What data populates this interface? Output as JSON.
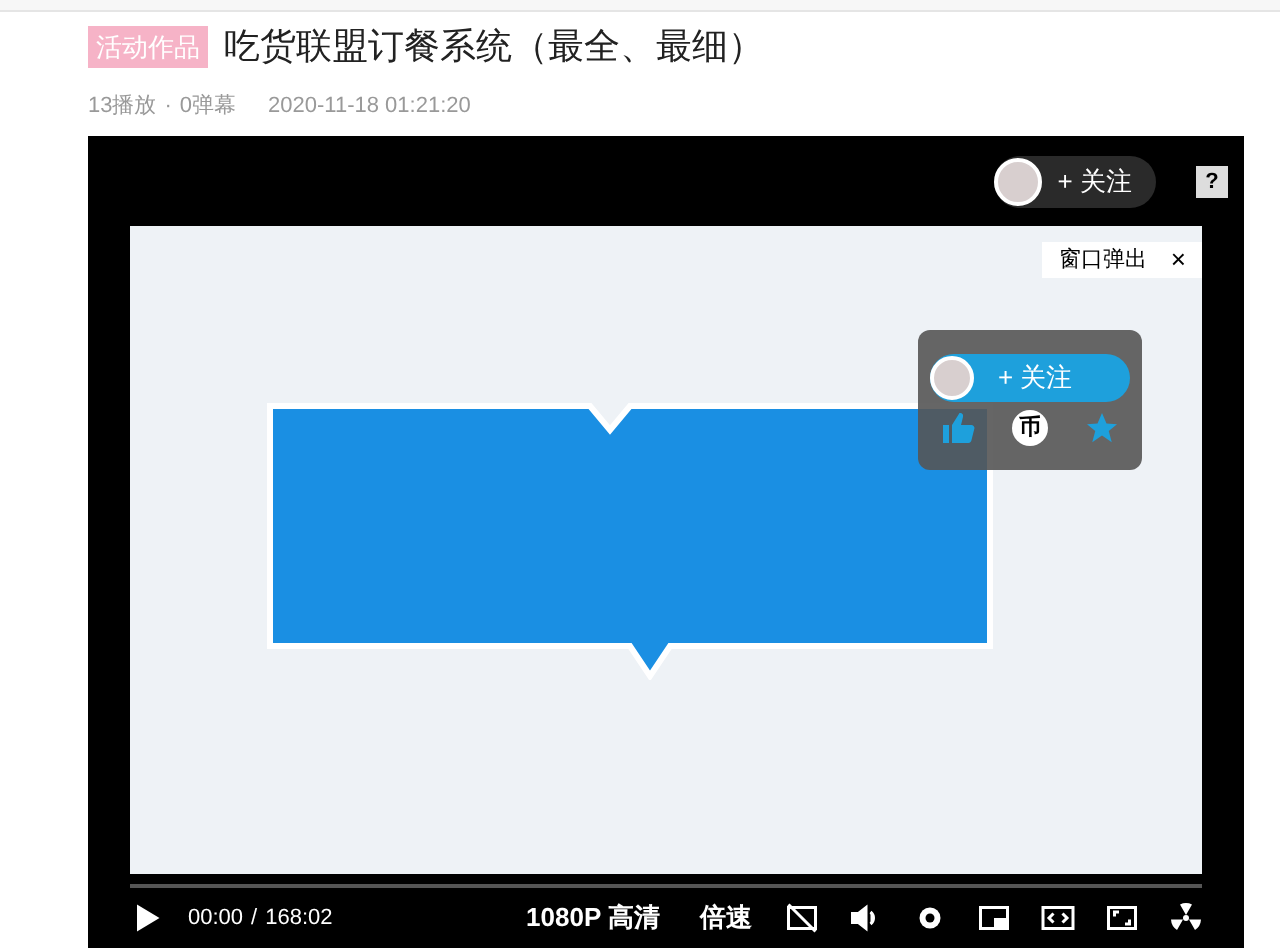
{
  "header": {
    "badge": "活动作品",
    "title": "吃货联盟订餐系统（最全、最细）",
    "plays": "13播放",
    "separator": "·",
    "danmaku": "0弹幕",
    "datetime": "2020-11-18 01:21:20"
  },
  "player": {
    "follow_label": "+ 关注",
    "help_label": "?",
    "popout_label": "窗口弹出",
    "popout_close": "×",
    "float_panel": {
      "follow_label": "+ 关注",
      "coin_label": "币"
    },
    "progress": {
      "level": 0
    },
    "time_current": "00:00",
    "time_separator": "/",
    "time_total": "168:02",
    "quality": "1080P 高清",
    "speed": "倍速",
    "paused": true
  }
}
